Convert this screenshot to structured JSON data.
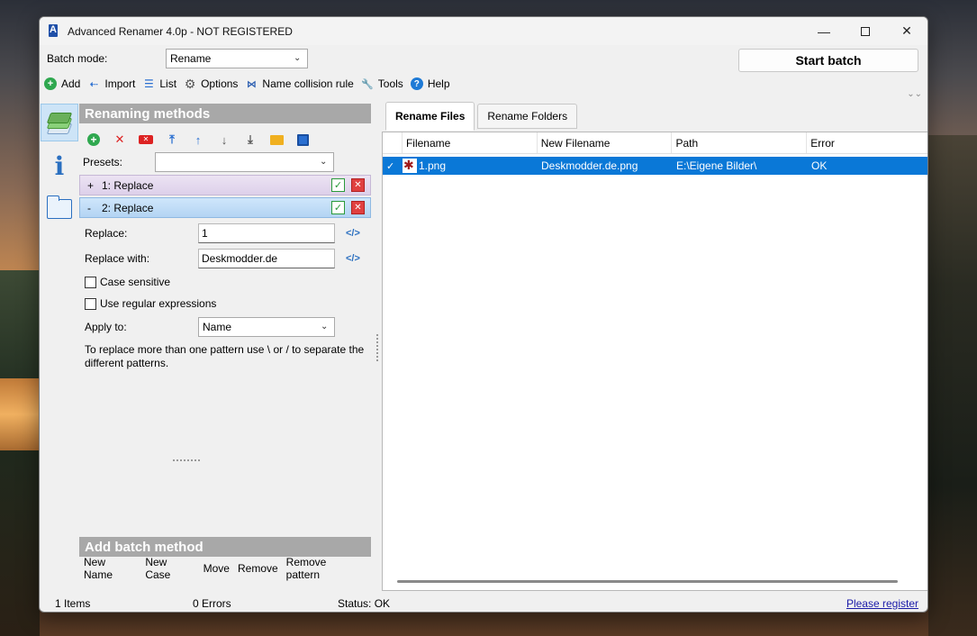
{
  "window": {
    "title": "Advanced Renamer 4.0p - NOT REGISTERED"
  },
  "batch_mode": {
    "label": "Batch mode:",
    "value": "Rename"
  },
  "start_batch": "Start batch",
  "toolbar": {
    "add": "Add",
    "import": "Import",
    "list": "List",
    "options": "Options",
    "name_collision_rule": "Name collision rule",
    "tools": "Tools",
    "help": "Help"
  },
  "renaming_methods": {
    "header": "Renaming methods",
    "presets_label": "Presets:",
    "presets_value": "",
    "methods": [
      {
        "toggle": "+",
        "label": "1: Replace"
      },
      {
        "toggle": "-",
        "label": "2: Replace"
      }
    ],
    "replace_label": "Replace:",
    "replace_value": "1",
    "replace_with_label": "Replace with:",
    "replace_with_value": "Deskmodder.de",
    "case_sensitive": "Case sensitive",
    "use_regex": "Use regular expressions",
    "apply_to_label": "Apply to:",
    "apply_to_value": "Name",
    "help_text": "To replace more than one pattern use \\ or / to separate the different patterns."
  },
  "add_batch_method": {
    "header": "Add batch method",
    "links": [
      "New Name",
      "New Case",
      "Move",
      "Remove",
      "Remove pattern"
    ]
  },
  "tabs": {
    "rename_files": "Rename Files",
    "rename_folders": "Rename Folders"
  },
  "file_list": {
    "columns": [
      "Filename",
      "New Filename",
      "Path",
      "Error"
    ],
    "rows": [
      {
        "filename": "1.png",
        "new_filename": "Deskmodder.de.png",
        "path": "E:\\Eigene Bilder\\",
        "error": "OK"
      }
    ]
  },
  "status": {
    "items": "1 Items",
    "errors": "0 Errors",
    "status": "Status: OK",
    "register": "Please register"
  },
  "colors": {
    "selection": "#0a78d7",
    "panel_header": "#a8a8a8"
  }
}
